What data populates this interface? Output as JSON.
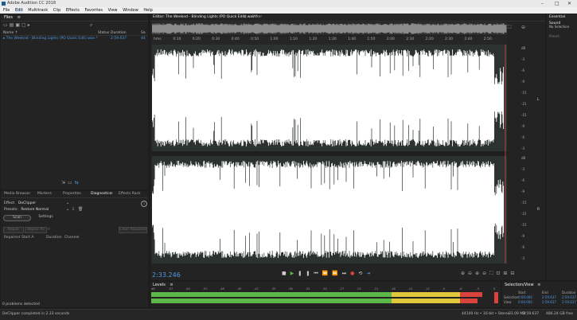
{
  "app": {
    "title": "Adobe Audition CC 2018",
    "menus": [
      "File",
      "Edit",
      "Multitrack",
      "Clip",
      "Effects",
      "Favorites",
      "View",
      "Window",
      "Help"
    ]
  },
  "files_panel": {
    "title": "Files",
    "columns": {
      "name": "Name ↑",
      "status": "Status",
      "duration": "Duration",
      "sample": "Sa"
    },
    "items": [
      {
        "name": "The Weeknd - Blinding Lights (PO Quick Edit).wav *",
        "duration": "2:59.637",
        "sample": "44"
      }
    ]
  },
  "bottom_left_panel": {
    "tabs": [
      "Media Browser",
      "Markers",
      "Properties",
      "Diagnostics",
      "Effects Rack"
    ],
    "active_tab": "Diagnostics",
    "effect_label": "Effect:",
    "effect_value": "DeClipper",
    "presets_label": "Presets:",
    "presets_value": "Restore Normal",
    "scan_label": "Scan",
    "settings_label": "Settings",
    "repair_label": "Repair",
    "repair_all_label": "Repair All",
    "clear_label": "Clear Repaired",
    "cols": {
      "repaired": "Repaired",
      "start": "Start A",
      "duration": "Duration",
      "channel": "Channel"
    },
    "footer": "0 problems detected"
  },
  "editor": {
    "tab": "Editor: The Weeknd - Blinding Lights (PO Quick Edit).wav *",
    "mixer_tab": "Mixer",
    "time_ruler": [
      "hms",
      "0:10",
      "0:20",
      "0:30",
      "0:40",
      "0:50",
      "1:00",
      "1:10",
      "1:20",
      "1:30",
      "1:40",
      "1:50",
      "2:00",
      "2:10",
      "2:20",
      "2:30",
      "2:40",
      "2:50"
    ],
    "db_labels": [
      "dB",
      "-3",
      "-6",
      "-9",
      "-15",
      "-21",
      "-15",
      "-9",
      "-6",
      "-3"
    ],
    "channels": [
      "L",
      "R"
    ],
    "current_time": "2:33.246"
  },
  "levels": {
    "title": "Levels",
    "scale": [
      "dB",
      "-57",
      "-54",
      "-51",
      "-48",
      "-45",
      "-42",
      "-39",
      "-36",
      "-33",
      "-30",
      "-27",
      "-24",
      "-21",
      "-18",
      "-15",
      "-12",
      "-9",
      "-6",
      "-3",
      "0"
    ]
  },
  "selection_view": {
    "title": "Selection/View",
    "columns": [
      "",
      "Start",
      "End",
      "Duration"
    ],
    "rows": [
      {
        "label": "Selection",
        "start": "0:00.000",
        "end": "2:59.637",
        "duration": "2:59.637"
      },
      {
        "label": "View",
        "start": "0:00.000",
        "end": "2:59.637",
        "duration": "2:59.637"
      }
    ]
  },
  "essential_sound": {
    "title": "Essential Sound",
    "no_selection": "No Selection",
    "preset": "Preset:"
  },
  "status_bar": {
    "left": "DeClipper completed in 2.33 seconds",
    "format": "44100 Hz • 16-bit • Stereo",
    "size": "31.09 MB",
    "duration": "2:59.637",
    "free": "486.24 GB free"
  },
  "colors": {
    "accent": "#4e9be3",
    "waveform": "#ffffff",
    "waveform_bg": "#2b3230",
    "meter_green": "#5db84a",
    "meter_yellow": "#e3c73a",
    "meter_red": "#d9433b",
    "playhead": "#e04848"
  }
}
